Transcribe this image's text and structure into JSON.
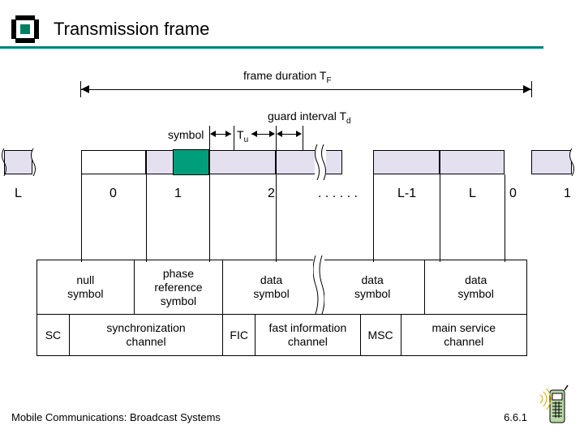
{
  "title": "Transmission frame",
  "labels": {
    "frame_duration_pre": "frame duration T",
    "frame_duration_sub": "F",
    "guard_pre": "guard interval T",
    "guard_sub": "d",
    "symbol": "symbol",
    "tu_pre": "T",
    "tu_sub": "u",
    "dots": ". . . . . ."
  },
  "indices": [
    "L",
    "0",
    "1",
    "2",
    "L-1",
    "L",
    "0",
    "1"
  ],
  "table": {
    "row1": [
      "null\nsymbol",
      "phase\nreference\nsymbol",
      "data\nsymbol",
      "data\nsymbol",
      "data\nsymbol"
    ],
    "row2": [
      "SC",
      "synchronization\nchannel",
      "FIC",
      "fast information\nchannel",
      "MSC",
      "main service\nchannel"
    ]
  },
  "footer": "Mobile Communications: Broadcast Systems",
  "slide": "6.6.1"
}
